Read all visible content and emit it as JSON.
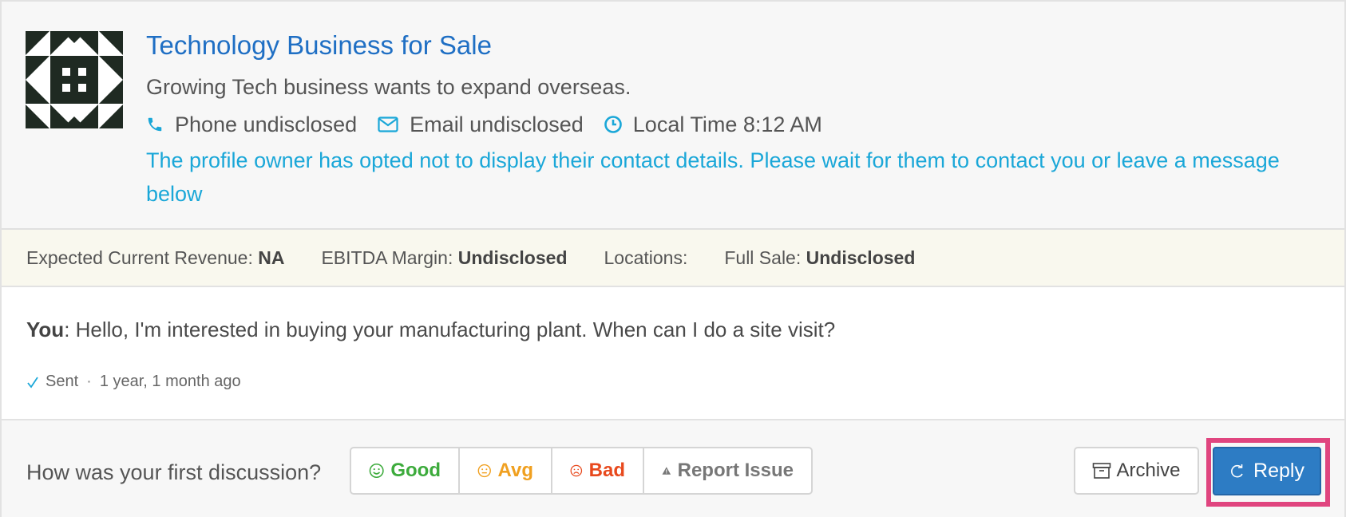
{
  "listing": {
    "title": "Technology Business for Sale",
    "subtitle": "Growing Tech business wants to expand overseas.",
    "phone": "Phone undisclosed",
    "email": "Email undisclosed",
    "local_time": "Local Time 8:12 AM",
    "notice": "The profile owner has opted not to display their contact details. Please wait for them to contact you or leave a message below"
  },
  "stats": [
    {
      "label": "Expected Current Revenue: ",
      "value": "NA"
    },
    {
      "label": "EBITDA Margin: ",
      "value": "Undisclosed"
    },
    {
      "label": "Locations: ",
      "value": ""
    },
    {
      "label": "Full Sale: ",
      "value": "Undisclosed"
    }
  ],
  "message": {
    "author": "You",
    "text": ": Hello, I'm interested in buying your manufacturing plant. When can I do a site visit?",
    "status": "Sent",
    "separator": "·",
    "time": "1 year, 1 month ago"
  },
  "feedback": {
    "question": "How was your first discussion?",
    "good": "Good",
    "avg": "Avg",
    "bad": "Bad",
    "report": "Report Issue"
  },
  "actions": {
    "archive": "Archive",
    "reply": "Reply"
  },
  "colors": {
    "title": "#1f6fc4",
    "accent": "#1aa7d8",
    "good": "#3dab3c",
    "avg": "#f0a020",
    "bad": "#e8491d",
    "reply_bg": "#2d7cc4",
    "highlight": "#e0457f"
  },
  "icons": [
    "avatar-identicon",
    "phone-icon",
    "envelope-icon",
    "clock-icon",
    "check-icon",
    "smile-icon",
    "meh-icon",
    "frown-icon",
    "warning-icon",
    "archive-icon",
    "reply-icon"
  ]
}
